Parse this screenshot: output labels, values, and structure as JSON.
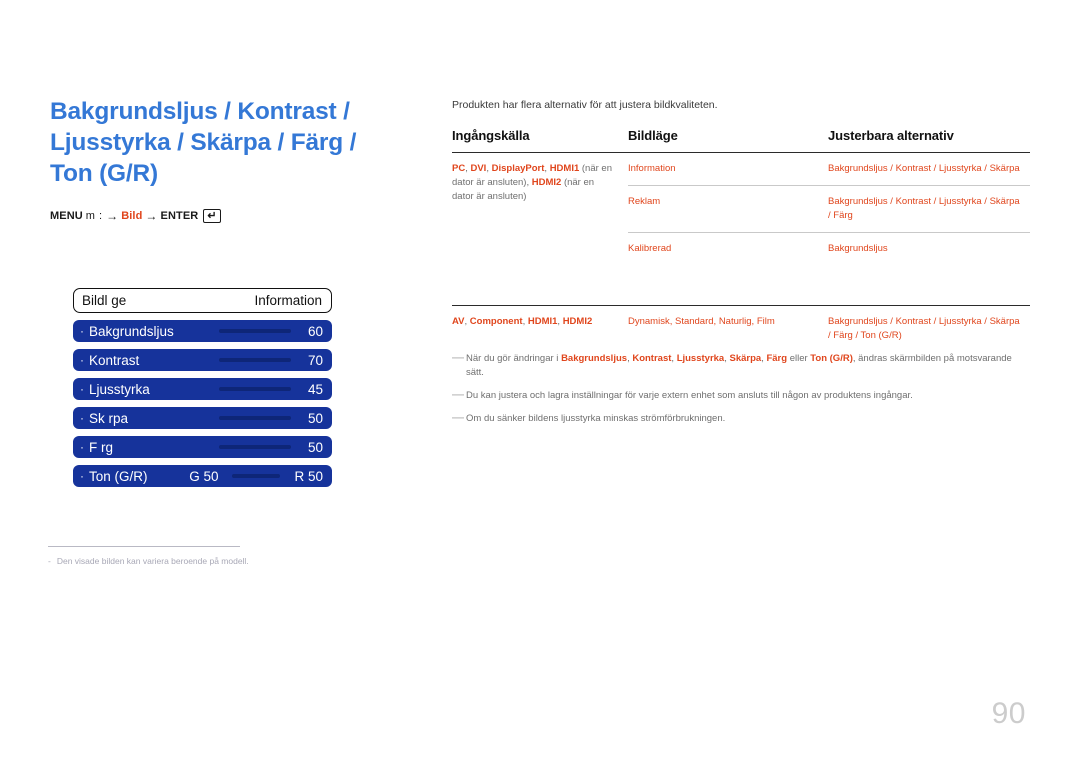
{
  "document": {
    "page_number": "90"
  },
  "section": {
    "title": "Bakgrundsljus / Kontrast / Ljusstyrka / Skärpa / Färg / Ton (G/R)",
    "menu_path": {
      "menu_label": "MENU",
      "menu_glyph": "m",
      "colon": ":",
      "arrow": "→",
      "target": "Bild",
      "enter_label": "ENTER",
      "enter_glyph": "↵"
    }
  },
  "osd": {
    "header": {
      "title": "Bildl ge",
      "value": "Information"
    },
    "rows": [
      {
        "bullet": "·",
        "label": "Bakgrundsljus",
        "value": "60",
        "slider": true
      },
      {
        "bullet": "·",
        "label": "Kontrast",
        "value": "70",
        "slider": true
      },
      {
        "bullet": "·",
        "label": "Ljusstyrka",
        "value": "45",
        "slider": true
      },
      {
        "bullet": "·",
        "label": "Sk rpa",
        "value": "50",
        "slider": true
      },
      {
        "bullet": "·",
        "label": "F rg",
        "value": "50",
        "slider": true
      },
      {
        "bullet": "·",
        "label": "Ton (G/R)",
        "value": "R 50",
        "left_value": "G 50",
        "slider": true
      }
    ]
  },
  "left_footnote": {
    "dash": "-",
    "text": "Den visade bilden kan variera beroende på modell."
  },
  "right": {
    "intro": "Produkten har flera alternativ för att justera bildkvaliteten.",
    "table": {
      "headers": [
        "Ingångskälla",
        "Bildläge",
        "Justerbara alternativ"
      ],
      "groups": [
        {
          "source_parts": [
            {
              "t": "PC",
              "kw": true
            },
            {
              "t": ", ",
              "kw": false
            },
            {
              "t": "DVI",
              "kw": true
            },
            {
              "t": ", ",
              "kw": false
            },
            {
              "t": "DisplayPort",
              "kw": true
            },
            {
              "t": ", ",
              "kw": false
            },
            {
              "t": "HDMI1",
              "kw": true
            },
            {
              "t": " (när en dator är ansluten), ",
              "kw": false
            },
            {
              "t": "HDMI2",
              "kw": true
            },
            {
              "t": " (när en dator är ansluten)",
              "kw": false
            }
          ],
          "source_plain": "PC, DVI, DisplayPort, HDMI1 (när en dator är ansluten), HDMI2 (när en dator är ansluten)",
          "rows": [
            {
              "mode": "Information",
              "options": "Bakgrundsljus / Kontrast / Ljusstyrka / Skärpa"
            },
            {
              "mode": "Reklam",
              "options": "Bakgrundsljus / Kontrast / Ljusstyrka / Skärpa / Färg"
            },
            {
              "mode": "Kalibrerad",
              "options": "Bakgrundsljus"
            }
          ]
        },
        {
          "source_parts": [
            {
              "t": "AV",
              "kw": true
            },
            {
              "t": ", ",
              "kw": false
            },
            {
              "t": "Component",
              "kw": true
            },
            {
              "t": ", ",
              "kw": false
            },
            {
              "t": "HDMI1",
              "kw": true
            },
            {
              "t": ", ",
              "kw": false
            },
            {
              "t": "HDMI2",
              "kw": true
            }
          ],
          "source_plain": "AV, Component, HDMI1, HDMI2",
          "rows": [
            {
              "mode": "Dynamisk, Standard, Naturlig, Film",
              "options": "Bakgrundsljus / Kontrast / Ljusstyrka / Skärpa / Färg / Ton (G/R)"
            }
          ]
        }
      ]
    },
    "notes": [
      {
        "dash": "—",
        "parts": [
          {
            "t": "När du gör ändringar i ",
            "kw": false
          },
          {
            "t": "Bakgrundsljus",
            "kw": true
          },
          {
            "t": ", ",
            "kw": false
          },
          {
            "t": "Kontrast",
            "kw": true
          },
          {
            "t": ", ",
            "kw": false
          },
          {
            "t": "Ljusstyrka",
            "kw": true
          },
          {
            "t": ", ",
            "kw": false
          },
          {
            "t": "Skärpa",
            "kw": true
          },
          {
            "t": ", ",
            "kw": false
          },
          {
            "t": "Färg",
            "kw": true
          },
          {
            "t": " eller ",
            "kw": false
          },
          {
            "t": "Ton (G/R)",
            "kw": true
          },
          {
            "t": ", ändras skärmbilden på motsvarande sätt.",
            "kw": false
          }
        ],
        "plain": "När du gör ändringar i Bakgrundsljus, Kontrast, Ljusstyrka, Skärpa, Färg eller Ton (G/R), ändras skärmbilden på motsvarande sätt."
      },
      {
        "dash": "—",
        "parts": [
          {
            "t": "Du kan justera och lagra inställningar för varje extern enhet som ansluts till någon av produktens ingångar.",
            "kw": false
          }
        ],
        "plain": "Du kan justera och lagra inställningar för varje extern enhet som ansluts till någon av produktens ingångar."
      },
      {
        "dash": "—",
        "parts": [
          {
            "t": "Om du sänker bildens ljusstyrka minskas strömförbrukningen.",
            "kw": false
          }
        ],
        "plain": "Om du sänker bildens ljusstyrka minskas strömförbrukningen."
      }
    ]
  },
  "colors": {
    "title_blue": "#3478d6",
    "osd_blue": "#16339b",
    "osd_slider": "#0e2678",
    "accent_red": "#e0461d",
    "body_gray": "#6f6f6f",
    "page_number_gray": "#cccccc"
  }
}
